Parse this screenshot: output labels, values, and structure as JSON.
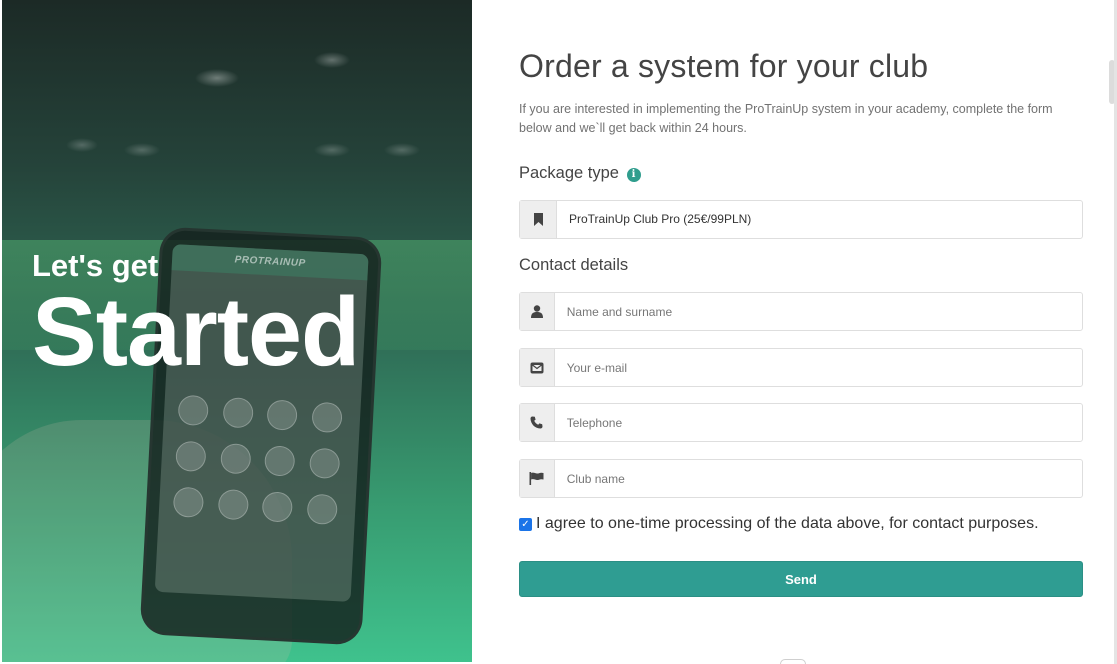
{
  "hero": {
    "line1": "Let's get",
    "line2": "Started",
    "phone_title": "PROTRAINUP"
  },
  "form": {
    "title": "Order a system for your club",
    "intro": "If you are interested in implementing the ProTrainUp system in your academy, complete the form below and we`ll get back within 24 hours.",
    "package_heading": "Package type",
    "package_value": "ProTrainUp Club Pro (25€/99PLN)",
    "contact_heading": "Contact details",
    "name_placeholder": "Name and surname",
    "email_placeholder": "Your e-mail",
    "phone_placeholder": "Telephone",
    "club_placeholder": "Club name",
    "agree_text": "I agree to one-time processing of the data above, for contact purposes.",
    "agree_checked": true,
    "send_label": "Send"
  },
  "icons": {
    "package": "bookmark-icon",
    "info": "info-icon",
    "name": "user-icon",
    "email": "envelope-icon",
    "phone": "phone-icon",
    "club": "flag-icon"
  },
  "colors": {
    "accent": "#2f9d92",
    "checkbox": "#1b74e8",
    "hero_gradient_bottom": "#3fc28d"
  }
}
